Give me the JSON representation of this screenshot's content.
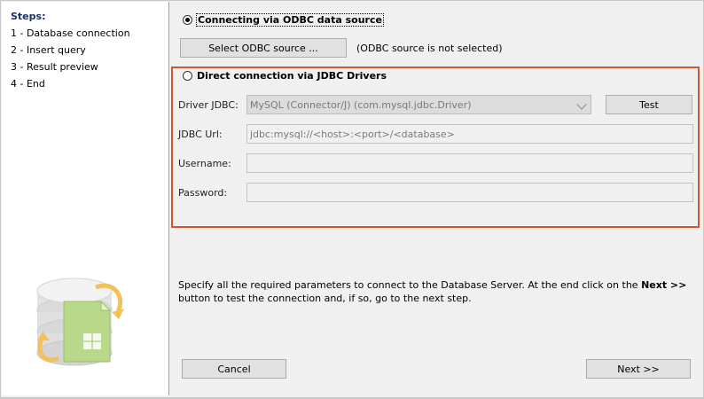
{
  "steps": {
    "title": "Steps:",
    "items": [
      "1 - Database connection",
      "2 - Insert query",
      "3 - Result preview",
      "4 - End"
    ]
  },
  "odbc": {
    "radio_label": "Connecting via ODBC data source",
    "selected": true,
    "select_button": "Select ODBC source ...",
    "status": "(ODBC source is not selected)"
  },
  "jdbc": {
    "radio_label": "Direct connection via JDBC Drivers",
    "selected": false,
    "driver_label": "Driver JDBC:",
    "driver_value": "MySQL (Connector/J) (com.mysql.jdbc.Driver)",
    "test_button": "Test",
    "url_label": "JDBC Url:",
    "url_value": "jdbc:mysql://<host>:<port>/<database>",
    "username_label": "Username:",
    "username_value": "",
    "password_label": "Password:",
    "password_value": ""
  },
  "info": {
    "text_before": "Specify all the required parameters to connect to the Database Server. At the end click on the ",
    "bold": "Next >>",
    "text_after": " button to test the connection and, if so, go to the next step."
  },
  "footer": {
    "cancel": "Cancel",
    "next": "Next >>"
  },
  "colors": {
    "highlight_border": "#d4562f",
    "steps_title": "#1a2f6d"
  }
}
